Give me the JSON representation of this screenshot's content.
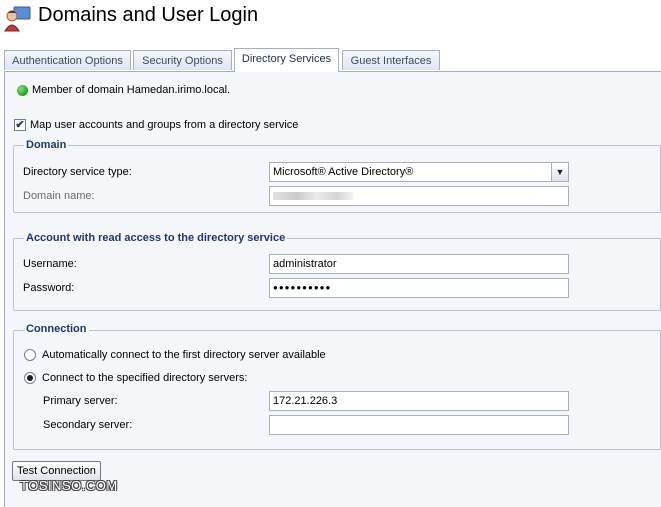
{
  "window": {
    "title": "Domains and User Login"
  },
  "tabs": [
    {
      "label": "Authentication Options",
      "active": false
    },
    {
      "label": "Security Options",
      "active": false
    },
    {
      "label": "Directory Services",
      "active": true
    },
    {
      "label": "Guest Interfaces",
      "active": false
    }
  ],
  "status": {
    "text": "Member of domain Hamedan.irimo.local.",
    "color": "#1ea51e"
  },
  "map_checkbox": {
    "label": "Map user accounts and groups from a directory service",
    "checked": true
  },
  "domain_group": {
    "legend": "Domain",
    "service_type_label": "Directory service type:",
    "service_type_value": "Microsoft® Active Directory®",
    "domain_name_label": "Domain name:",
    "domain_name_value": ""
  },
  "account_group": {
    "legend": "Account with read access to the directory service",
    "username_label": "Username:",
    "username_value": "administrator",
    "password_label": "Password:",
    "password_value": "●●●●●●●●●●"
  },
  "connection_group": {
    "legend": "Connection",
    "auto_option": "Automatically connect to the first directory server available",
    "specified_option": "Connect to the specified directory servers:",
    "selected": "specified",
    "primary_label": "Primary server:",
    "primary_value": "172.21.226.3",
    "secondary_label": "Secondary server:",
    "secondary_value": ""
  },
  "test_button": {
    "label": "Test Connection"
  },
  "watermark": {
    "text": "TOSINSO.COM"
  },
  "colors": {
    "accent": "#1a3a6e",
    "tab_border": "#9fb0c8",
    "panel_bg": "#f4f6f9"
  }
}
